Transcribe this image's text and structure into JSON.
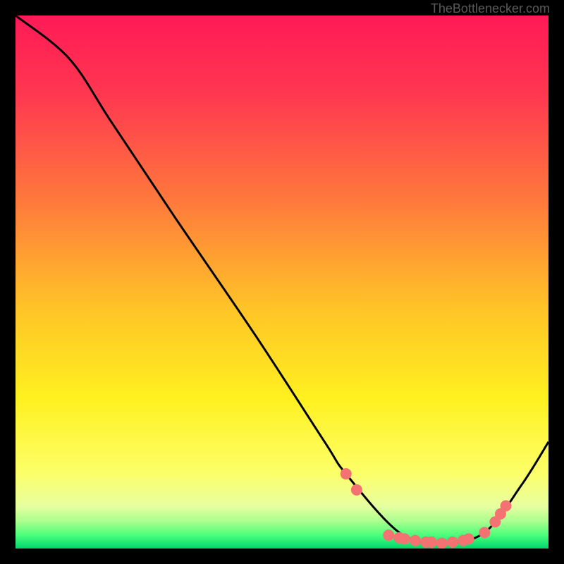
{
  "watermark": "TheBottlenecker.com",
  "chart_data": {
    "type": "line",
    "title": "",
    "xlabel": "",
    "ylabel": "",
    "xlim": [
      0,
      100
    ],
    "ylim": [
      0,
      100
    ],
    "curve_points": [
      {
        "x": 0,
        "y": 100
      },
      {
        "x": 10,
        "y": 92
      },
      {
        "x": 18,
        "y": 80
      },
      {
        "x": 30,
        "y": 62
      },
      {
        "x": 45,
        "y": 40
      },
      {
        "x": 58,
        "y": 20
      },
      {
        "x": 62,
        "y": 14
      },
      {
        "x": 72,
        "y": 3
      },
      {
        "x": 80,
        "y": 1
      },
      {
        "x": 88,
        "y": 3
      },
      {
        "x": 95,
        "y": 12
      },
      {
        "x": 100,
        "y": 20
      }
    ],
    "marker_points": [
      {
        "x": 62,
        "y": 14
      },
      {
        "x": 64,
        "y": 11
      },
      {
        "x": 70,
        "y": 2.5
      },
      {
        "x": 72,
        "y": 2
      },
      {
        "x": 73,
        "y": 1.8
      },
      {
        "x": 75,
        "y": 1.5
      },
      {
        "x": 77,
        "y": 1.2
      },
      {
        "x": 78,
        "y": 1.2
      },
      {
        "x": 80,
        "y": 1
      },
      {
        "x": 82,
        "y": 1.2
      },
      {
        "x": 84,
        "y": 1.5
      },
      {
        "x": 85,
        "y": 1.8
      },
      {
        "x": 88,
        "y": 3
      },
      {
        "x": 90,
        "y": 5
      },
      {
        "x": 91,
        "y": 6.5
      },
      {
        "x": 92,
        "y": 8
      }
    ],
    "gradient_stops": [
      {
        "pos": 0,
        "color": "#ff1a56"
      },
      {
        "pos": 15,
        "color": "#ff3850"
      },
      {
        "pos": 35,
        "color": "#ff7a3c"
      },
      {
        "pos": 55,
        "color": "#ffc427"
      },
      {
        "pos": 72,
        "color": "#fff120"
      },
      {
        "pos": 86,
        "color": "#fdff6a"
      },
      {
        "pos": 92,
        "color": "#e8ffa0"
      },
      {
        "pos": 95,
        "color": "#a8ff8e"
      },
      {
        "pos": 97.5,
        "color": "#4aff7a"
      },
      {
        "pos": 100,
        "color": "#00d66e"
      }
    ],
    "marker_color": "#f47272",
    "curve_color": "#000000"
  }
}
